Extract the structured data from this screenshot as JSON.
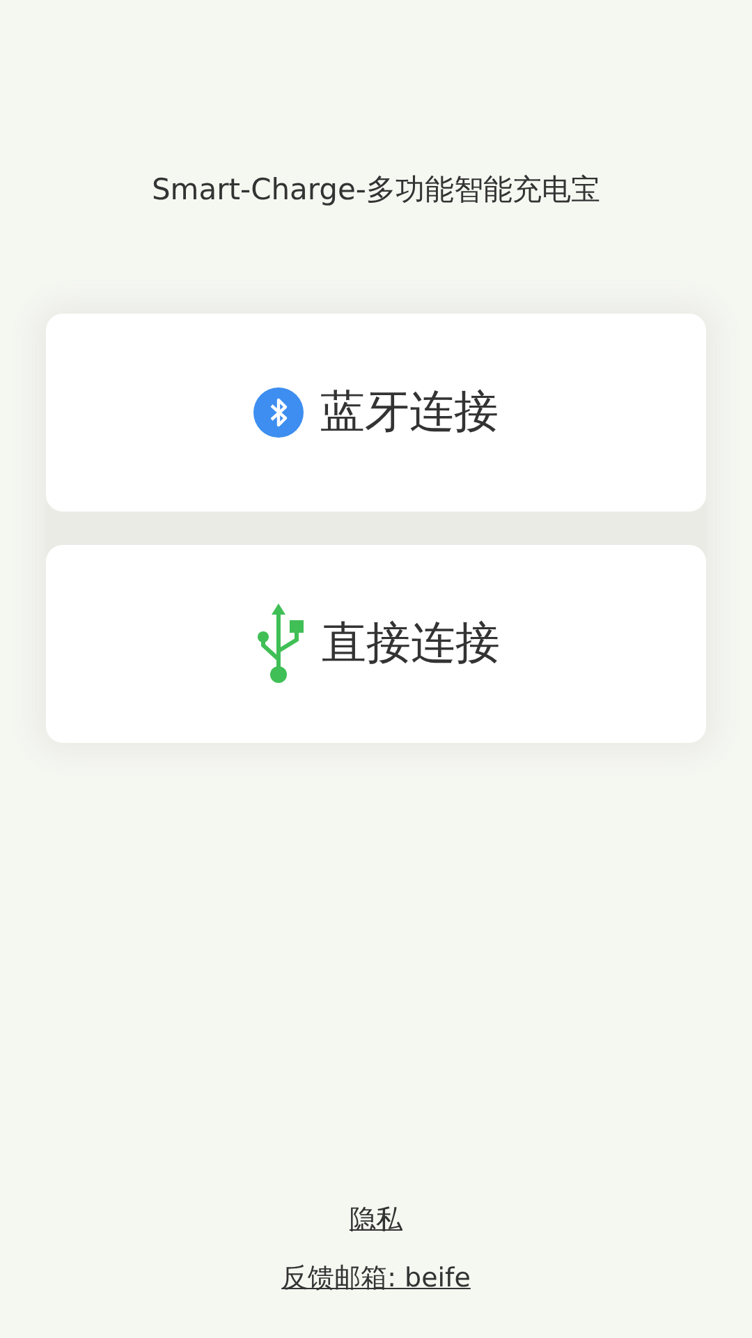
{
  "title": "Smart-Charge-多功能智能充电宝",
  "options": [
    {
      "kind": "bluetooth",
      "label": "蓝牙连接"
    },
    {
      "kind": "usb",
      "label": "直接连接"
    }
  ],
  "footer_links": [
    "隐私",
    "反馈邮箱: beife"
  ]
}
